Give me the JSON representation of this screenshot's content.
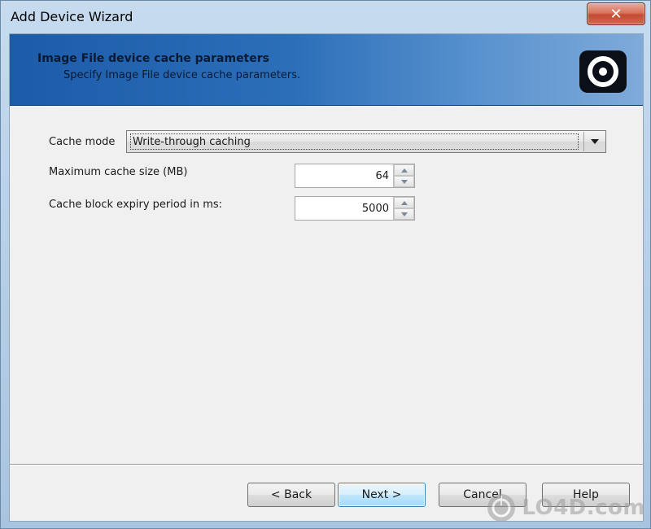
{
  "window": {
    "title": "Add Device Wizard",
    "close_glyph": "✕"
  },
  "header": {
    "title": "Image File device cache parameters",
    "subtitle": "Specify Image File device cache parameters.",
    "logo_icon": "disk-target-icon"
  },
  "form": {
    "cache_mode": {
      "label": "Cache mode",
      "value": "Write-through caching"
    },
    "max_cache_size": {
      "label": "Maximum cache size (MB)",
      "value": "64"
    },
    "expiry_period": {
      "label": "Cache block expiry period in ms:",
      "value": "5000"
    }
  },
  "buttons": {
    "back": "< Back",
    "next": "Next >",
    "cancel": "Cancel",
    "help": "Help"
  },
  "watermark": {
    "text": "LO4D.com"
  },
  "colors": {
    "header_start": "#1c5ba8",
    "header_end": "#7faad9",
    "close_button": "#c34a31",
    "client_bg": "#f0f0f0"
  }
}
